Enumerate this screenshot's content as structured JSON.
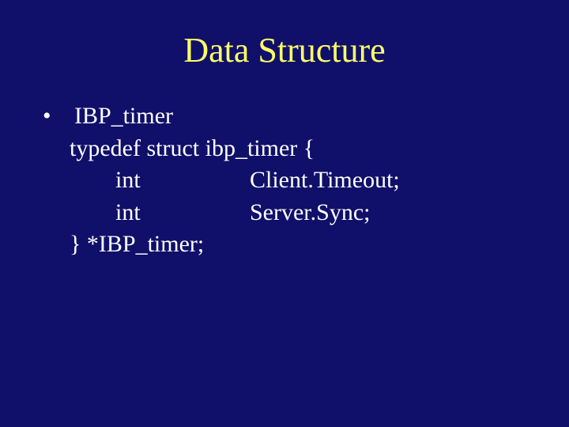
{
  "title": "Data Structure",
  "bullet": {
    "mark": "•",
    "label": "IBP_timer"
  },
  "code": {
    "line1": "typedef struct ibp_timer {",
    "field1_type": "int",
    "field1_name": "Client.Timeout;",
    "field2_type": "int",
    "field2_name": "Server.Sync;",
    "line_end": "} *IBP_timer;"
  }
}
